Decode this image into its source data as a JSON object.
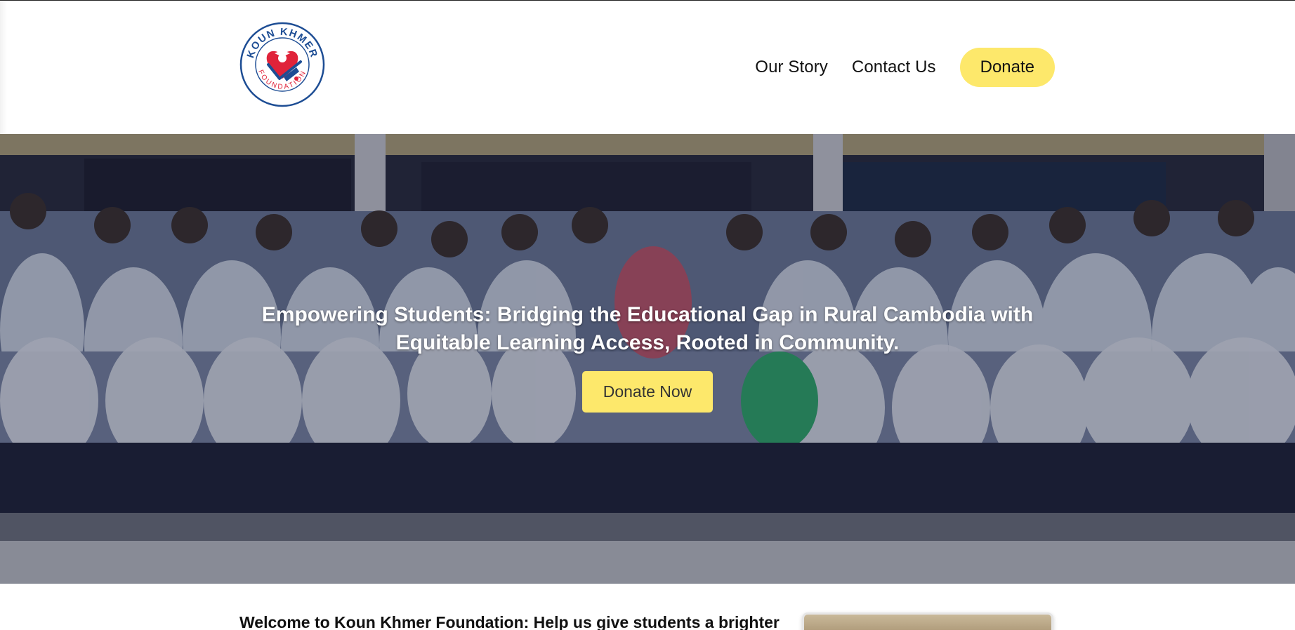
{
  "brand": {
    "logo_top": "KOUN KHMER",
    "logo_bottom": "FOUNDATION",
    "logo_colors": {
      "navy": "#1d4d94",
      "red": "#e0233a"
    }
  },
  "nav": {
    "items": [
      {
        "label": "Our Story"
      },
      {
        "label": "Contact Us"
      }
    ],
    "donate_label": "Donate",
    "accent": "#fde86b"
  },
  "hero": {
    "headline": "Empowering Students: Bridging the Educational Gap in Rural Cambodia with Equitable Learning Access, Rooted in Community.",
    "cta_label": "Donate Now"
  },
  "welcome": {
    "title": "Welcome to Koun Khmer Foundation: Help us give students a brighter"
  }
}
